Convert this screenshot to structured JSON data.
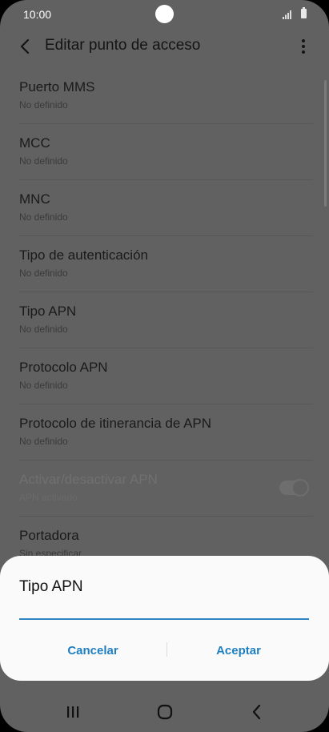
{
  "status": {
    "time": "10:00"
  },
  "appbar": {
    "title": "Editar punto de acceso"
  },
  "settings": [
    {
      "label": "Puerto MMS",
      "value": "No definido"
    },
    {
      "label": "MCC",
      "value": "No definido"
    },
    {
      "label": "MNC",
      "value": "No definido"
    },
    {
      "label": "Tipo de autenticación",
      "value": "No definido"
    },
    {
      "label": "Tipo APN",
      "value": "No definido"
    },
    {
      "label": "Protocolo APN",
      "value": "No definido"
    },
    {
      "label": "Protocolo de itinerancia de APN",
      "value": "No definido"
    },
    {
      "label": "Activar/desactivar APN",
      "value": "APN activado",
      "toggle_on": true
    },
    {
      "label": "Portadora",
      "value": "Sin especificar"
    }
  ],
  "dialog": {
    "title": "Tipo APN",
    "input_value": "",
    "cancel_label": "Cancelar",
    "ok_label": "Aceptar"
  },
  "colors": {
    "accent": "#1f7fc0",
    "overlay": "#616161"
  }
}
